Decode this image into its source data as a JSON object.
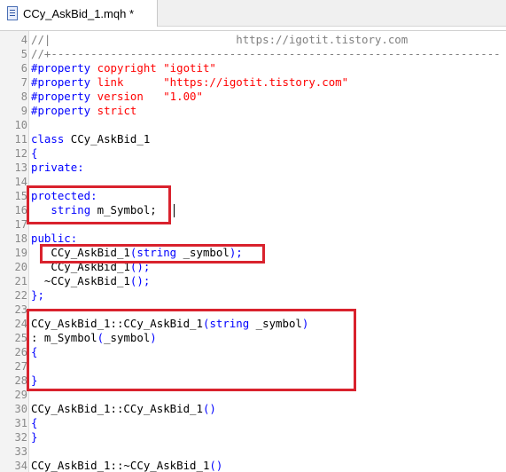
{
  "tab": {
    "title": "CCy_AskBid_1.mqh *",
    "icon": "file-icon"
  },
  "colors": {
    "keyword": "#0000ff",
    "string": "#ff0000",
    "comment": "#808080",
    "highlight": "#d9222d"
  },
  "lines": [
    {
      "no": "4",
      "tokens": [
        {
          "t": "//|",
          "c": "g"
        },
        {
          "t": "                            https://igotit.tistory.com",
          "c": "g"
        }
      ]
    },
    {
      "no": "5",
      "tokens": [
        {
          "t": "//+--------------------------------------------------------------------",
          "c": "g"
        }
      ]
    },
    {
      "no": "6",
      "tokens": [
        {
          "t": "#property ",
          "c": "k"
        },
        {
          "t": "copyright ",
          "c": "r"
        },
        {
          "t": "\"igotit\"",
          "c": "r"
        }
      ]
    },
    {
      "no": "7",
      "tokens": [
        {
          "t": "#property ",
          "c": "k"
        },
        {
          "t": "link      ",
          "c": "r"
        },
        {
          "t": "\"https://igotit.tistory.com\"",
          "c": "r"
        }
      ]
    },
    {
      "no": "8",
      "tokens": [
        {
          "t": "#property ",
          "c": "k"
        },
        {
          "t": "version   ",
          "c": "r"
        },
        {
          "t": "\"1.00\"",
          "c": "r"
        }
      ]
    },
    {
      "no": "9",
      "tokens": [
        {
          "t": "#property ",
          "c": "k"
        },
        {
          "t": "strict",
          "c": "r"
        }
      ]
    },
    {
      "no": "10",
      "tokens": []
    },
    {
      "no": "11",
      "tokens": [
        {
          "t": "class ",
          "c": "k"
        },
        {
          "t": "CCy_AskBid_1",
          "c": ""
        }
      ]
    },
    {
      "no": "12",
      "tokens": [
        {
          "t": "{",
          "c": "k"
        }
      ]
    },
    {
      "no": "13",
      "tokens": [
        {
          "t": "private:",
          "c": "k"
        }
      ]
    },
    {
      "no": "14",
      "tokens": []
    },
    {
      "no": "15",
      "tokens": [
        {
          "t": "protected:",
          "c": "k"
        }
      ]
    },
    {
      "no": "16",
      "tokens": [
        {
          "t": "   ",
          "c": ""
        },
        {
          "t": "string ",
          "c": "k"
        },
        {
          "t": "m_Symbol;",
          "c": ""
        }
      ]
    },
    {
      "no": "17",
      "tokens": []
    },
    {
      "no": "18",
      "tokens": [
        {
          "t": "public:",
          "c": "k"
        }
      ]
    },
    {
      "no": "19",
      "tokens": [
        {
          "t": "   CCy_AskBid_1",
          "c": ""
        },
        {
          "t": "(",
          "c": "k"
        },
        {
          "t": "string ",
          "c": "k"
        },
        {
          "t": "_symbol",
          "c": ""
        },
        {
          "t": ");",
          "c": "k"
        }
      ]
    },
    {
      "no": "20",
      "tokens": [
        {
          "t": "   CCy_AskBid_1",
          "c": ""
        },
        {
          "t": "();",
          "c": "k"
        }
      ]
    },
    {
      "no": "21",
      "tokens": [
        {
          "t": "  ~CCy_AskBid_1",
          "c": ""
        },
        {
          "t": "();",
          "c": "k"
        }
      ]
    },
    {
      "no": "22",
      "tokens": [
        {
          "t": "};",
          "c": "k"
        }
      ]
    },
    {
      "no": "23",
      "tokens": []
    },
    {
      "no": "24",
      "tokens": [
        {
          "t": "CCy_AskBid_1::CCy_AskBid_1",
          "c": ""
        },
        {
          "t": "(",
          "c": "k"
        },
        {
          "t": "string ",
          "c": "k"
        },
        {
          "t": "_symbol",
          "c": ""
        },
        {
          "t": ")",
          "c": "k"
        }
      ]
    },
    {
      "no": "25",
      "tokens": [
        {
          "t": ": m_Symbol",
          "c": ""
        },
        {
          "t": "(",
          "c": "k"
        },
        {
          "t": "_symbol",
          "c": ""
        },
        {
          "t": ")",
          "c": "k"
        }
      ]
    },
    {
      "no": "26",
      "tokens": [
        {
          "t": "{",
          "c": "k"
        }
      ]
    },
    {
      "no": "27",
      "tokens": []
    },
    {
      "no": "28",
      "tokens": [
        {
          "t": "}",
          "c": "k"
        }
      ]
    },
    {
      "no": "29",
      "tokens": []
    },
    {
      "no": "30",
      "tokens": [
        {
          "t": "CCy_AskBid_1::CCy_AskBid_1",
          "c": ""
        },
        {
          "t": "()",
          "c": "k"
        }
      ]
    },
    {
      "no": "31",
      "tokens": [
        {
          "t": "{",
          "c": "k"
        }
      ]
    },
    {
      "no": "32",
      "tokens": [
        {
          "t": "}",
          "c": "k"
        }
      ]
    },
    {
      "no": "33",
      "tokens": []
    },
    {
      "no": "34",
      "tokens": [
        {
          "t": "CCy_AskBid_1::~CCy_AskBid_1",
          "c": ""
        },
        {
          "t": "()",
          "c": "k"
        }
      ]
    }
  ]
}
